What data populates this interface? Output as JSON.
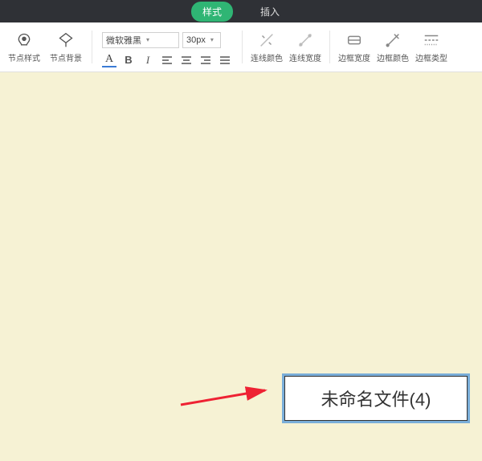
{
  "topbar": {
    "tabs": [
      {
        "label": "样式",
        "active": true
      },
      {
        "label": "插入",
        "active": false
      }
    ]
  },
  "toolbar": {
    "node_style_label": "节点样式",
    "node_bg_label": "节点背景",
    "font_name": "微软雅黑",
    "font_size": "30px",
    "line_color_label": "连线颜色",
    "line_width_label": "连线宽度",
    "border_width_label": "边框宽度",
    "border_color_label": "边框颜色",
    "border_type_label": "边框类型"
  },
  "canvas": {
    "node_text": "未命名文件(4)"
  }
}
